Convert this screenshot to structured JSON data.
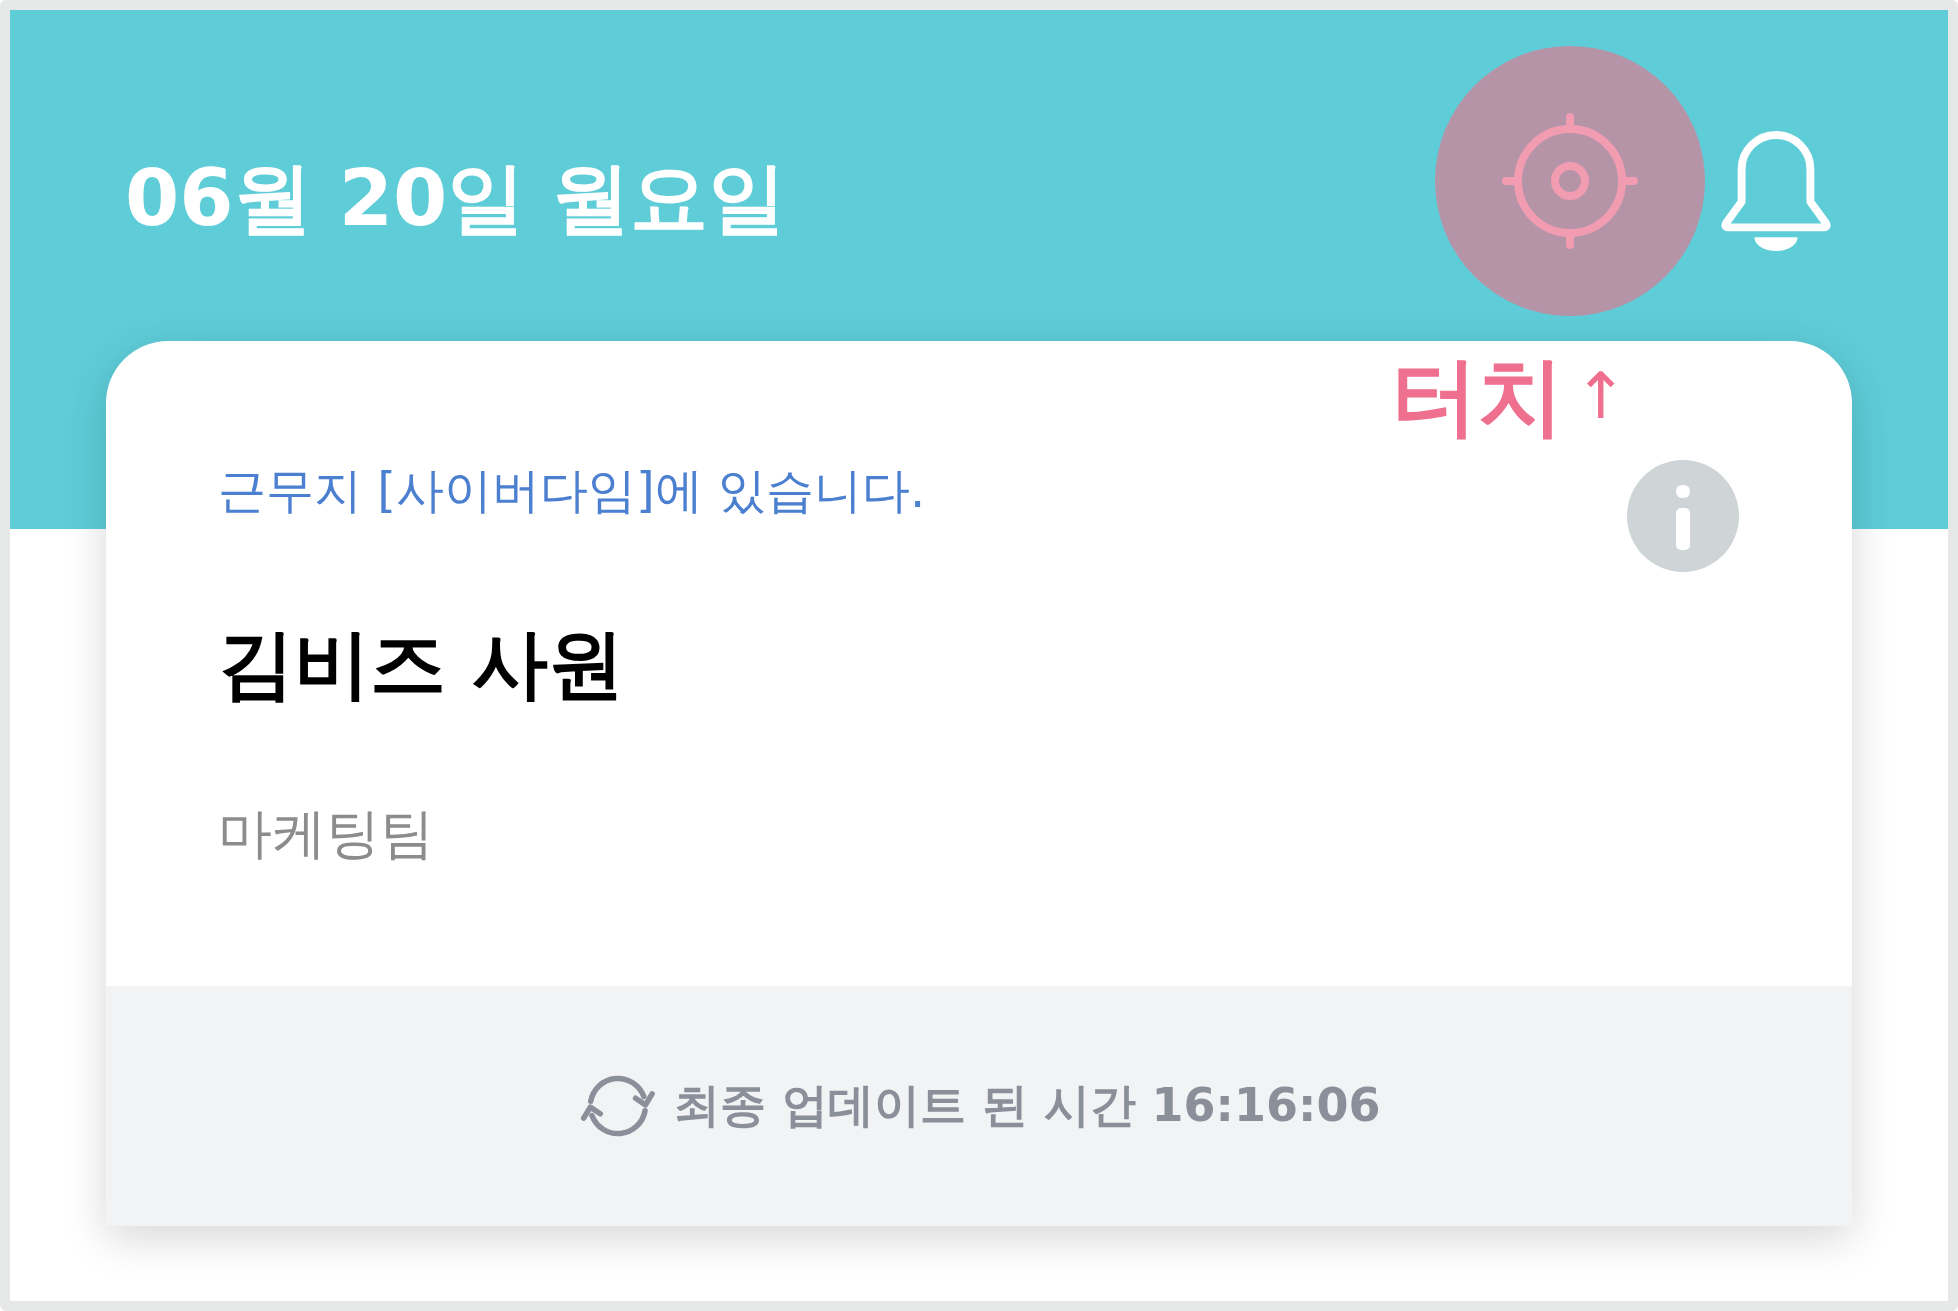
{
  "header": {
    "date": "06월 20일 월요일",
    "location_button": {
      "highlighted": true
    }
  },
  "annotation": {
    "label": "터치",
    "arrow": "↑"
  },
  "card": {
    "location_status": "근무지 [사이버다임]에 있습니다.",
    "name": "김비즈 사원",
    "team": "마케팅팀",
    "footer": {
      "last_updated": "최종 업데이트 된 시간 16:16:06"
    }
  }
}
